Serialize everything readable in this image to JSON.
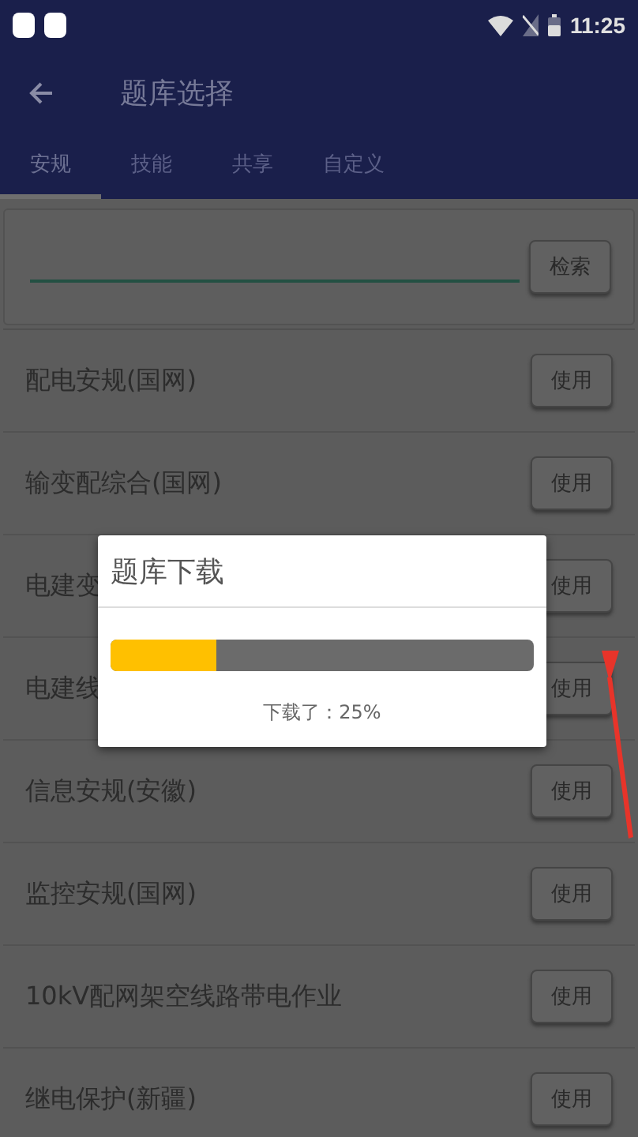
{
  "status_bar": {
    "time": "11:25"
  },
  "toolbar": {
    "title": "题库选择"
  },
  "tabs": [
    {
      "label": "安规",
      "selected": true
    },
    {
      "label": "技能",
      "selected": false
    },
    {
      "label": "共享",
      "selected": false
    },
    {
      "label": "自定义",
      "selected": false
    }
  ],
  "search": {
    "button": "检索"
  },
  "banks": [
    {
      "name": "配电安规(国网)",
      "button": "使用"
    },
    {
      "name": "输变配综合(国网)",
      "button": "使用"
    },
    {
      "name": "电建变",
      "button": "使用"
    },
    {
      "name": "电建线",
      "button": "使用"
    },
    {
      "name": "信息安规(安徽)",
      "button": "使用"
    },
    {
      "name": "监控安规(国网)",
      "button": "使用"
    },
    {
      "name": "10kV配网架空线路带电作业",
      "button": "使用"
    },
    {
      "name": "继电保护(新疆)",
      "button": "使用"
    }
  ],
  "dialog": {
    "title": "题库下载",
    "level": 0.25,
    "status": "下载了：25%"
  }
}
